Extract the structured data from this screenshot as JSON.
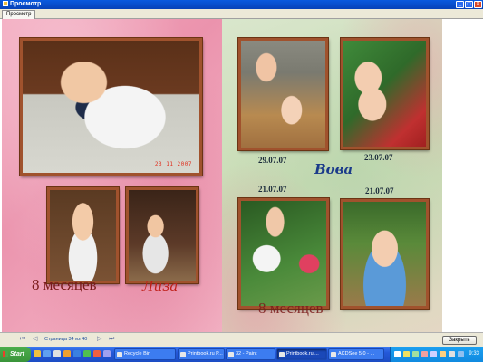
{
  "window": {
    "title": "Просмотр",
    "tab": "Просмотр",
    "controls": {
      "minimize": "_",
      "maximize": "□",
      "close": "×"
    }
  },
  "album": {
    "left_page": {
      "stamp_date": "23 11 2007",
      "caption_months": "8 месяцев",
      "caption_name": "Лиза"
    },
    "right_page": {
      "dates": [
        "29.07.07",
        "23.07.07",
        "21.07.07",
        "21.07.07"
      ],
      "caption_name": "Вова",
      "caption_months": "8 месяцев"
    }
  },
  "navigation": {
    "first": "⏮",
    "prev": "◁",
    "page_info": "Страница 34 из 40",
    "next": "▷",
    "last": "⏭",
    "close_label": "Закрыть"
  },
  "taskbar": {
    "start_label": "Start",
    "tasks": [
      {
        "label": "Recycle Bin",
        "active": false
      },
      {
        "label": "Printbook.ru P...",
        "active": false
      },
      {
        "label": "32 - Paint",
        "active": false
      },
      {
        "label": "Printbook.ru ...",
        "active": true
      },
      {
        "label": "ACDSee 5.0 - ...",
        "active": false
      }
    ],
    "clock": "9:33"
  },
  "colors": {
    "title_bar": "#0842b8",
    "frame_brown": "#a0522d",
    "caption_red": "#c0201a",
    "caption_blue": "#1a3a8a"
  }
}
